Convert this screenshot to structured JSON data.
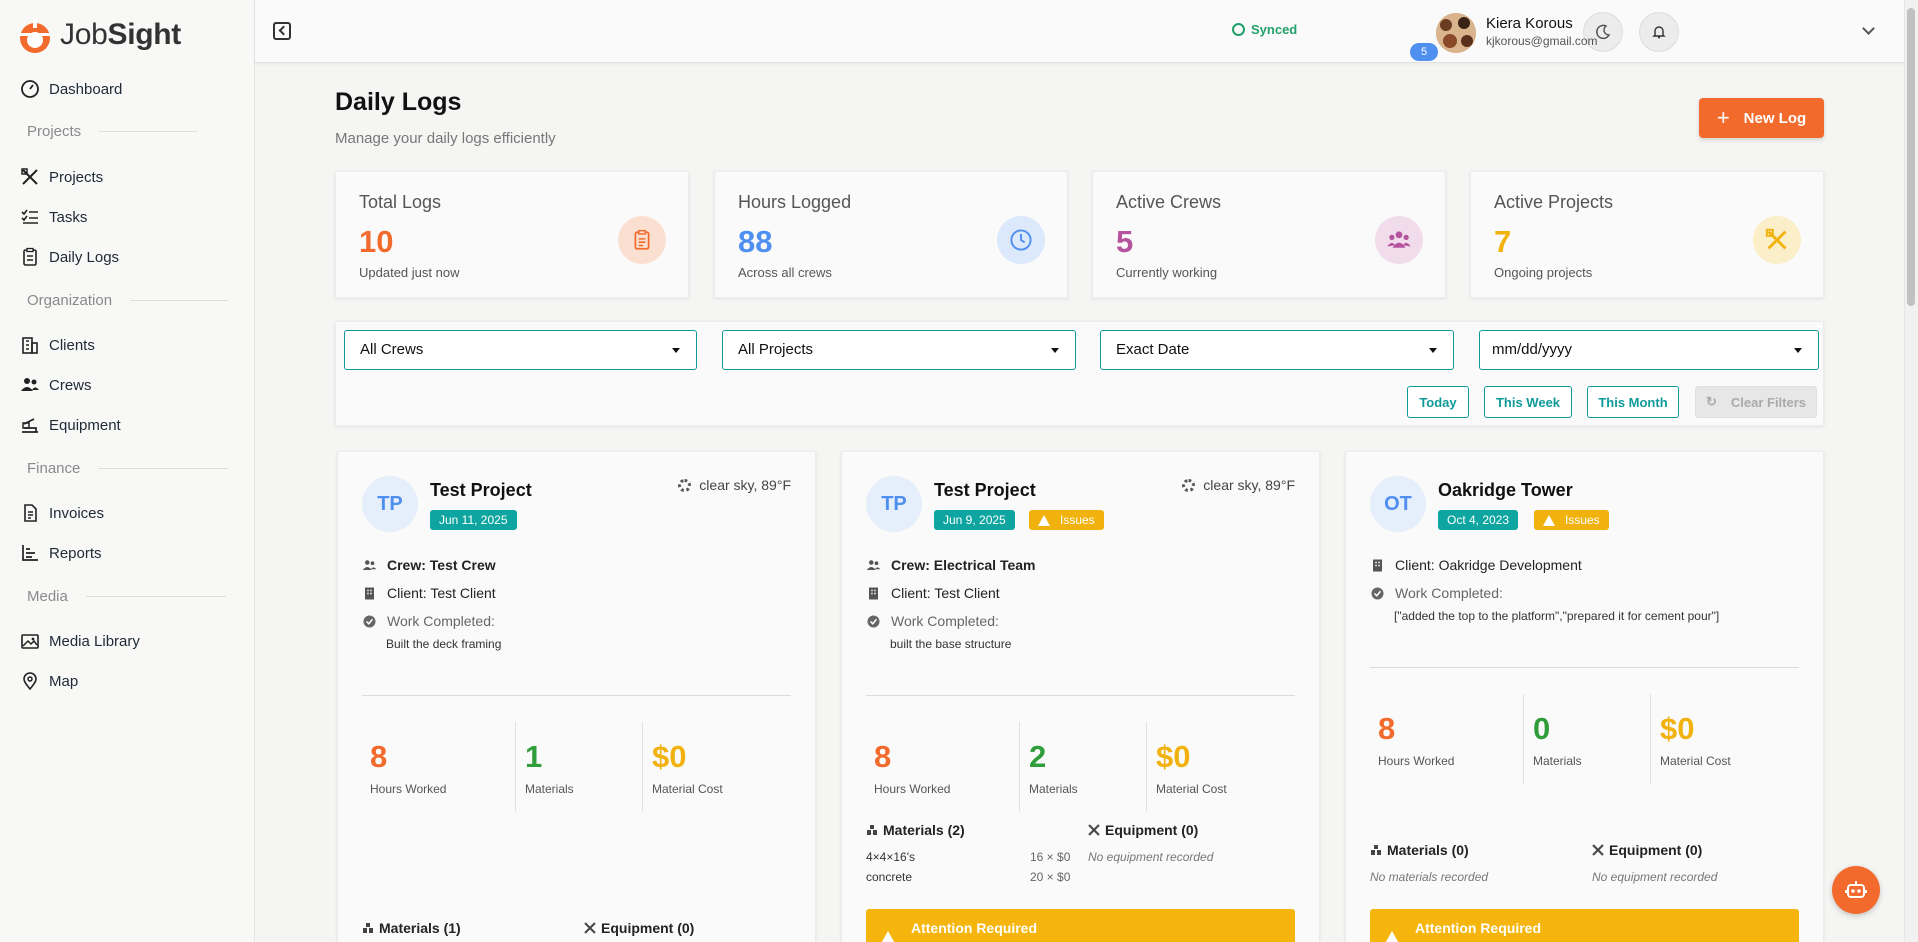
{
  "app": {
    "logo_part1": "Job",
    "logo_part2": "Sight"
  },
  "sidebar": {
    "dashboard": "Dashboard",
    "sections": {
      "projects": "Projects",
      "organization": "Organization",
      "finance": "Finance",
      "media": "Media"
    },
    "items": {
      "projects": "Projects",
      "tasks": "Tasks",
      "daily_logs": "Daily Logs",
      "clients": "Clients",
      "crews": "Crews",
      "equipment": "Equipment",
      "invoices": "Invoices",
      "reports": "Reports",
      "media_library": "Media Library",
      "map": "Map"
    }
  },
  "topbar": {
    "sync_status": "Synced",
    "notification_count": "5",
    "user_name": "Kiera Korous",
    "user_email": "kjkorous@gmail.com"
  },
  "page": {
    "title": "Daily Logs",
    "subtitle": "Manage your daily logs efficiently",
    "new_log_label": "New Log",
    "new_log_icon": "+"
  },
  "stats": [
    {
      "label": "Total Logs",
      "value": "10",
      "sub": "Updated just now",
      "color": "#f26b2c",
      "icon": "clipboard-icon"
    },
    {
      "label": "Hours Logged",
      "value": "88",
      "sub": "Across all crews",
      "color": "#4f8ff0",
      "icon": "clock-icon"
    },
    {
      "label": "Active Crews",
      "value": "5",
      "sub": "Currently working",
      "color": "#b5539e",
      "icon": "users-icon"
    },
    {
      "label": "Active Projects",
      "value": "7",
      "sub": "Ongoing projects",
      "color": "#f1b20d",
      "icon": "tools-icon"
    }
  ],
  "filters": {
    "crew": "All Crews",
    "project": "All Projects",
    "date_mode": "Exact Date",
    "date_placeholder": "mm/dd/yyyy",
    "today": "Today",
    "this_week": "This Week",
    "this_month": "This Month",
    "clear": "Clear Filters"
  },
  "cards": [
    {
      "initials": "TP",
      "title": "Test Project",
      "date": "Jun 11, 2025",
      "issues": "",
      "weather": "clear sky, 89°F",
      "crew": "Crew: Test Crew",
      "client": "Client: Test Client",
      "work_label": "Work Completed:",
      "work": "Built the deck framing",
      "hours": "8",
      "hours_label": "Hours Worked",
      "materials": "1",
      "materials_label": "Materials",
      "cost": "$0",
      "cost_label": "Material Cost",
      "materials_head": "Materials (1)",
      "equipment_head": "Equipment (0)"
    },
    {
      "initials": "TP",
      "title": "Test Project",
      "date": "Jun 9, 2025",
      "issues": "Issues",
      "weather": "clear sky, 89°F",
      "crew": "Crew: Electrical Team",
      "client": "Client: Test Client",
      "work_label": "Work Completed:",
      "work": "built the base structure",
      "hours": "8",
      "hours_label": "Hours Worked",
      "materials": "2",
      "materials_label": "Materials",
      "cost": "$0",
      "cost_label": "Material Cost",
      "materials_head": "Materials (2)",
      "equipment_head": "Equipment (0)",
      "material_items": [
        {
          "name": "4×4×16's",
          "qty": "16 × $0"
        },
        {
          "name": "concrete",
          "qty": "20 × $0"
        }
      ],
      "no_equipment": "No equipment recorded",
      "attention": "Attention Required"
    },
    {
      "initials": "OT",
      "title": "Oakridge Tower",
      "date": "Oct 4, 2023",
      "issues": "Issues",
      "client": "Client: Oakridge Development",
      "work_label": "Work Completed:",
      "work": "[\"added the top to the platform\",\"prepared it for cement pour\"]",
      "hours": "8",
      "hours_label": "Hours Worked",
      "materials": "0",
      "materials_label": "Materials",
      "cost": "$0",
      "cost_label": "Material Cost",
      "materials_head": "Materials (0)",
      "equipment_head": "Equipment (0)",
      "no_materials": "No materials recorded",
      "no_equipment": "No equipment recorded",
      "attention": "Attention Required"
    }
  ]
}
